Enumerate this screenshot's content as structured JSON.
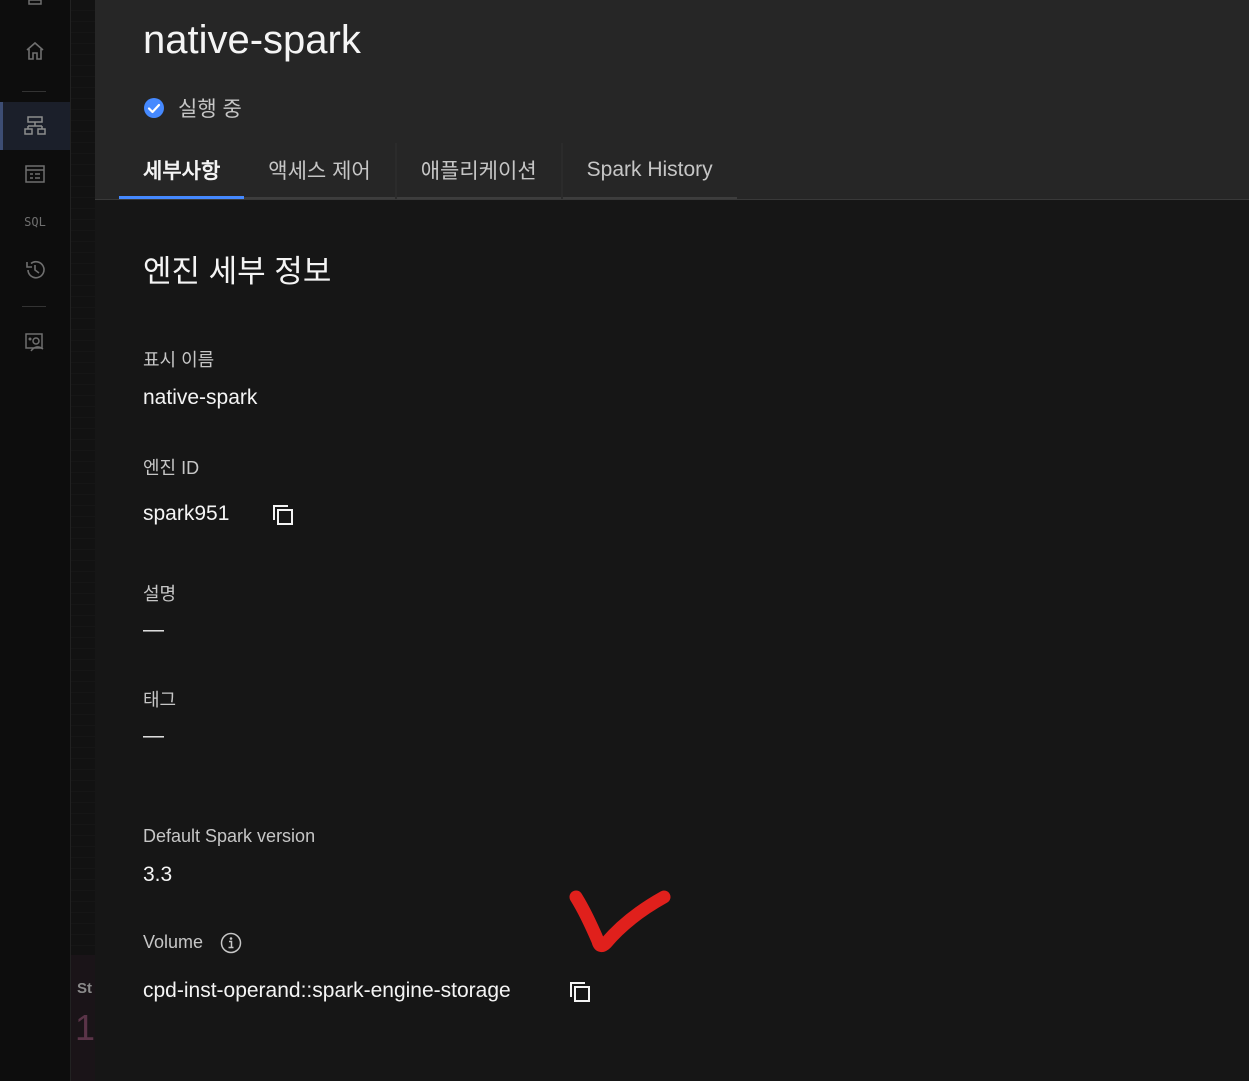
{
  "sidebar": {
    "items": [
      {
        "icon": "home-icon"
      },
      {
        "icon": "instances-icon",
        "active": true
      },
      {
        "icon": "data-manager-icon"
      },
      {
        "icon": "sql-icon",
        "label": "SQL"
      },
      {
        "icon": "history-icon"
      },
      {
        "icon": "access-control-icon"
      }
    ]
  },
  "header": {
    "title": "native-spark",
    "status": "실행 중",
    "status_color": "#4589ff",
    "tabs": [
      {
        "label": "세부사항",
        "active": true
      },
      {
        "label": "액세스 제어"
      },
      {
        "label": "애플리케이션"
      },
      {
        "label": "Spark History"
      }
    ]
  },
  "details": {
    "section_title": "엔진 세부 정보",
    "display_name_label": "표시 이름",
    "display_name": "native-spark",
    "engine_id_label": "엔진 ID",
    "engine_id": "spark951",
    "description_label": "설명",
    "description": "—",
    "tags_label": "태그",
    "tags": "—",
    "spark_version_label": "Default Spark version",
    "spark_version": "3.3",
    "volume_label": "Volume",
    "volume": "cpd-inst-operand::spark-engine-storage"
  },
  "background": {
    "partial_text": "St",
    "partial_number": "1"
  },
  "annotation": {
    "color": "#e0201c"
  }
}
